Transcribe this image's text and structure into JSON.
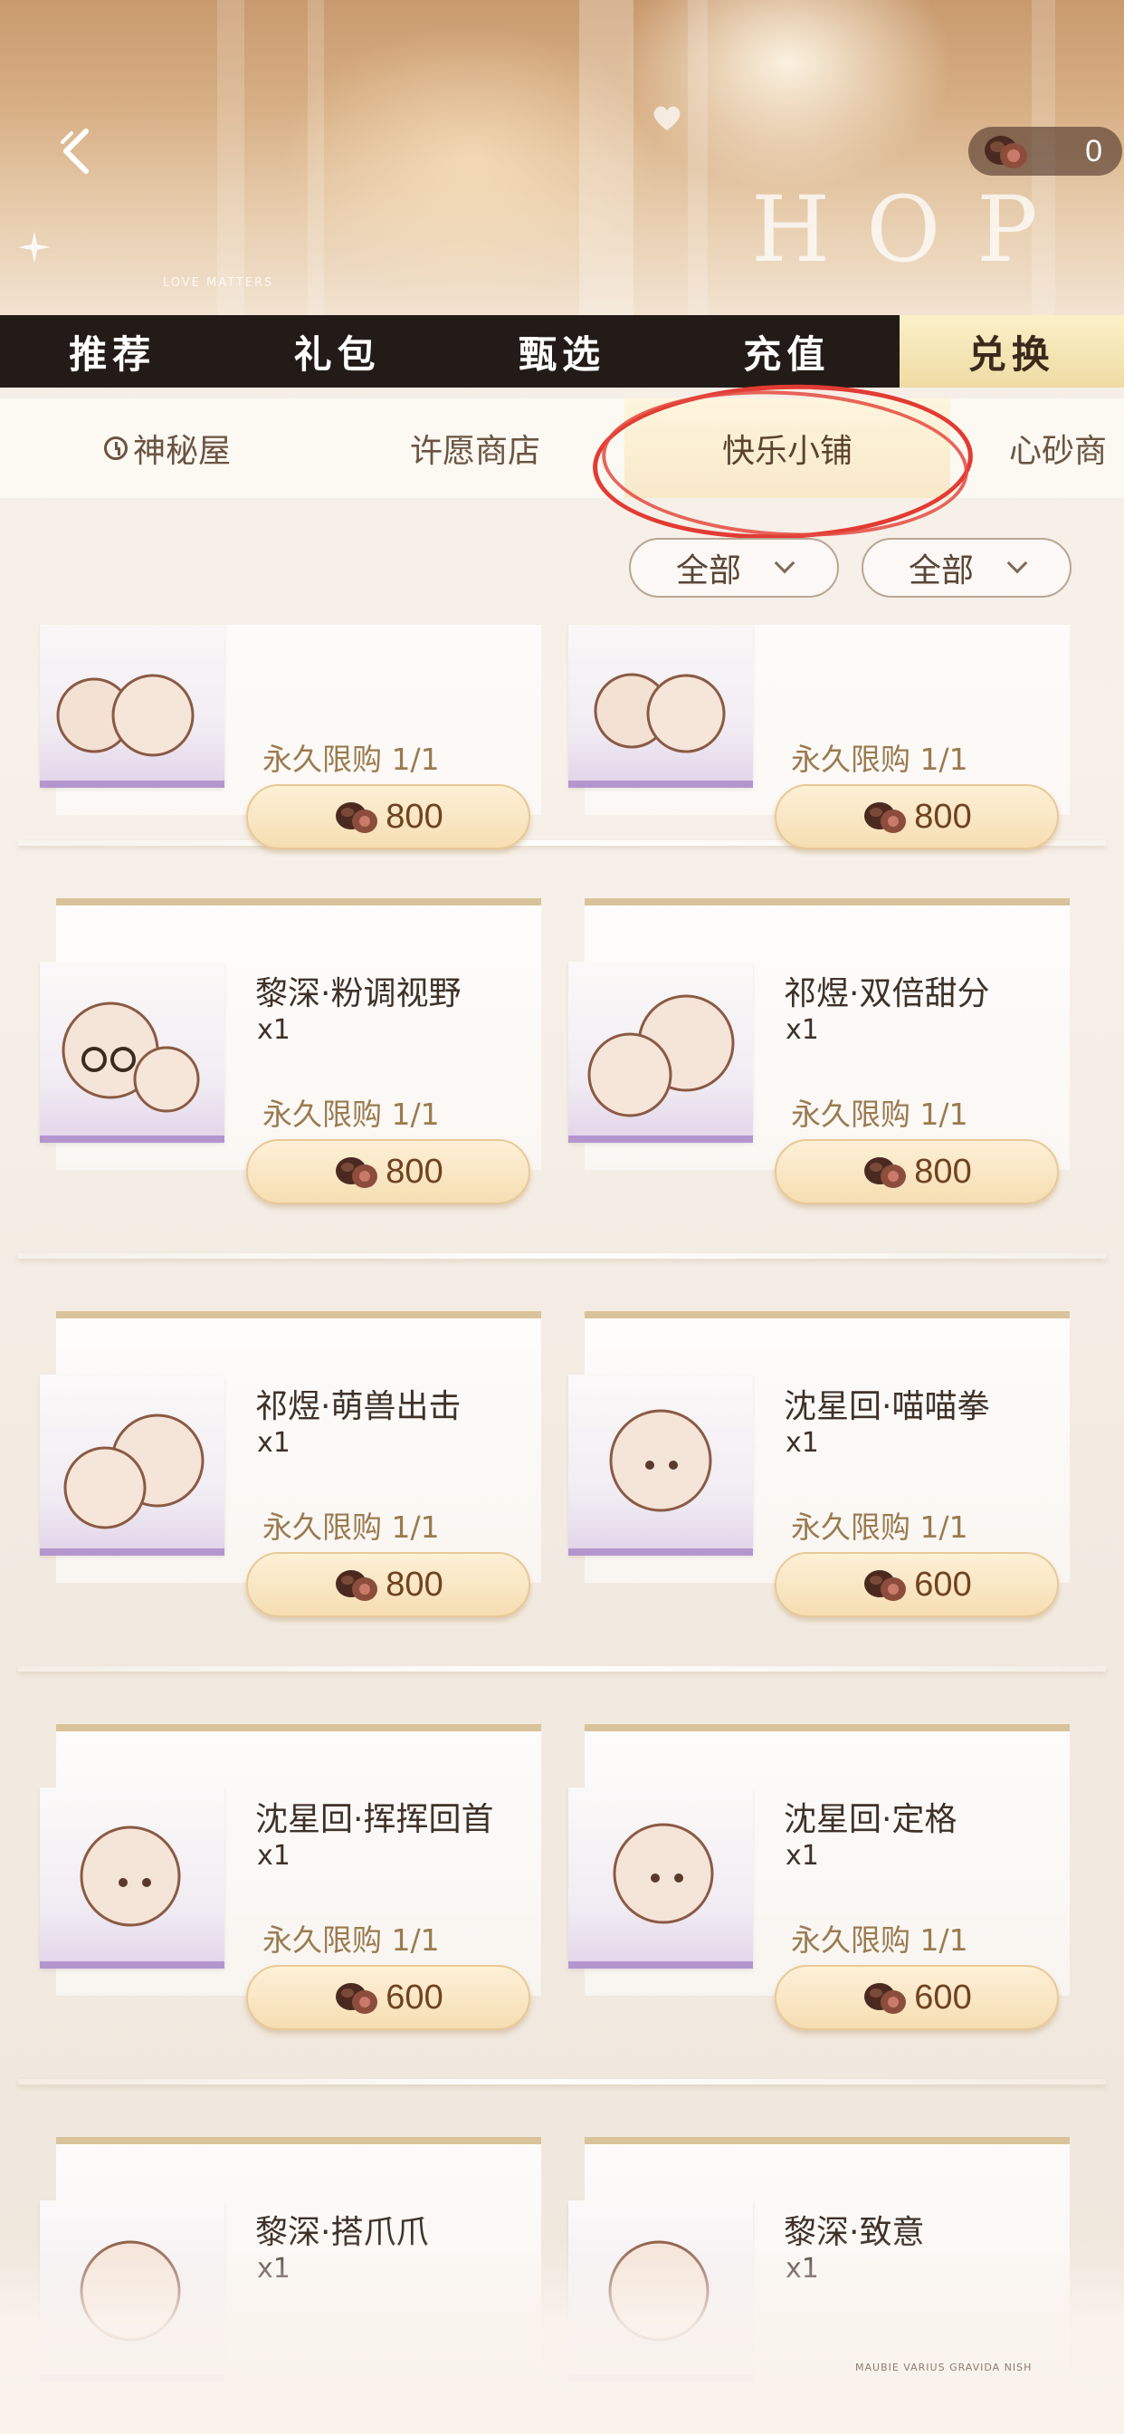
{
  "header": {
    "currency_count": "0",
    "banner_word": "HOP",
    "banner_small_text": "LOVE MATTERS",
    "footer_text": "MAUBIE VARIUS GRAVIDA NISH"
  },
  "main_tabs": [
    {
      "label": "推荐",
      "active": false
    },
    {
      "label": "礼包",
      "active": false
    },
    {
      "label": "甄选",
      "active": false
    },
    {
      "label": "充值",
      "active": false
    },
    {
      "label": "兑换",
      "active": true
    }
  ],
  "sub_tabs": [
    {
      "label": "神秘屋",
      "icon": "clock-icon",
      "active": false
    },
    {
      "label": "许愿商店",
      "active": false
    },
    {
      "label": "快乐小铺",
      "active": true
    },
    {
      "label": "心砂商",
      "active": false
    }
  ],
  "filters": [
    {
      "label": "全部"
    },
    {
      "label": "全部"
    }
  ],
  "items": [
    {
      "name": "",
      "qty": "",
      "limit": "永久限购 1/1",
      "price": "800"
    },
    {
      "name": "",
      "qty": "",
      "limit": "永久限购 1/1",
      "price": "800"
    },
    {
      "name": "黎深·粉调视野",
      "qty": "x1",
      "limit": "永久限购 1/1",
      "price": "800"
    },
    {
      "name": "祁煜·双倍甜分",
      "qty": "x1",
      "limit": "永久限购 1/1",
      "price": "800"
    },
    {
      "name": "祁煜·萌兽出击",
      "qty": "x1",
      "limit": "永久限购 1/1",
      "price": "800"
    },
    {
      "name": "沈星回·喵喵拳",
      "qty": "x1",
      "limit": "永久限购 1/1",
      "price": "600"
    },
    {
      "name": "沈星回·挥挥回首",
      "qty": "x1",
      "limit": "永久限购 1/1",
      "price": "600"
    },
    {
      "name": "沈星回·定格",
      "qty": "x1",
      "limit": "永久限购 1/1",
      "price": "600"
    },
    {
      "name": "黎深·搭爪爪",
      "qty": "x1",
      "limit": "",
      "price": ""
    },
    {
      "name": "黎深·致意",
      "qty": "x1",
      "limit": "",
      "price": ""
    }
  ],
  "colors": {
    "accent_red_annotation": "#e23b33",
    "tab_bar_dark": "#231b17",
    "active_tab_gold": "#efdca4",
    "price_text": "#6f4222"
  }
}
